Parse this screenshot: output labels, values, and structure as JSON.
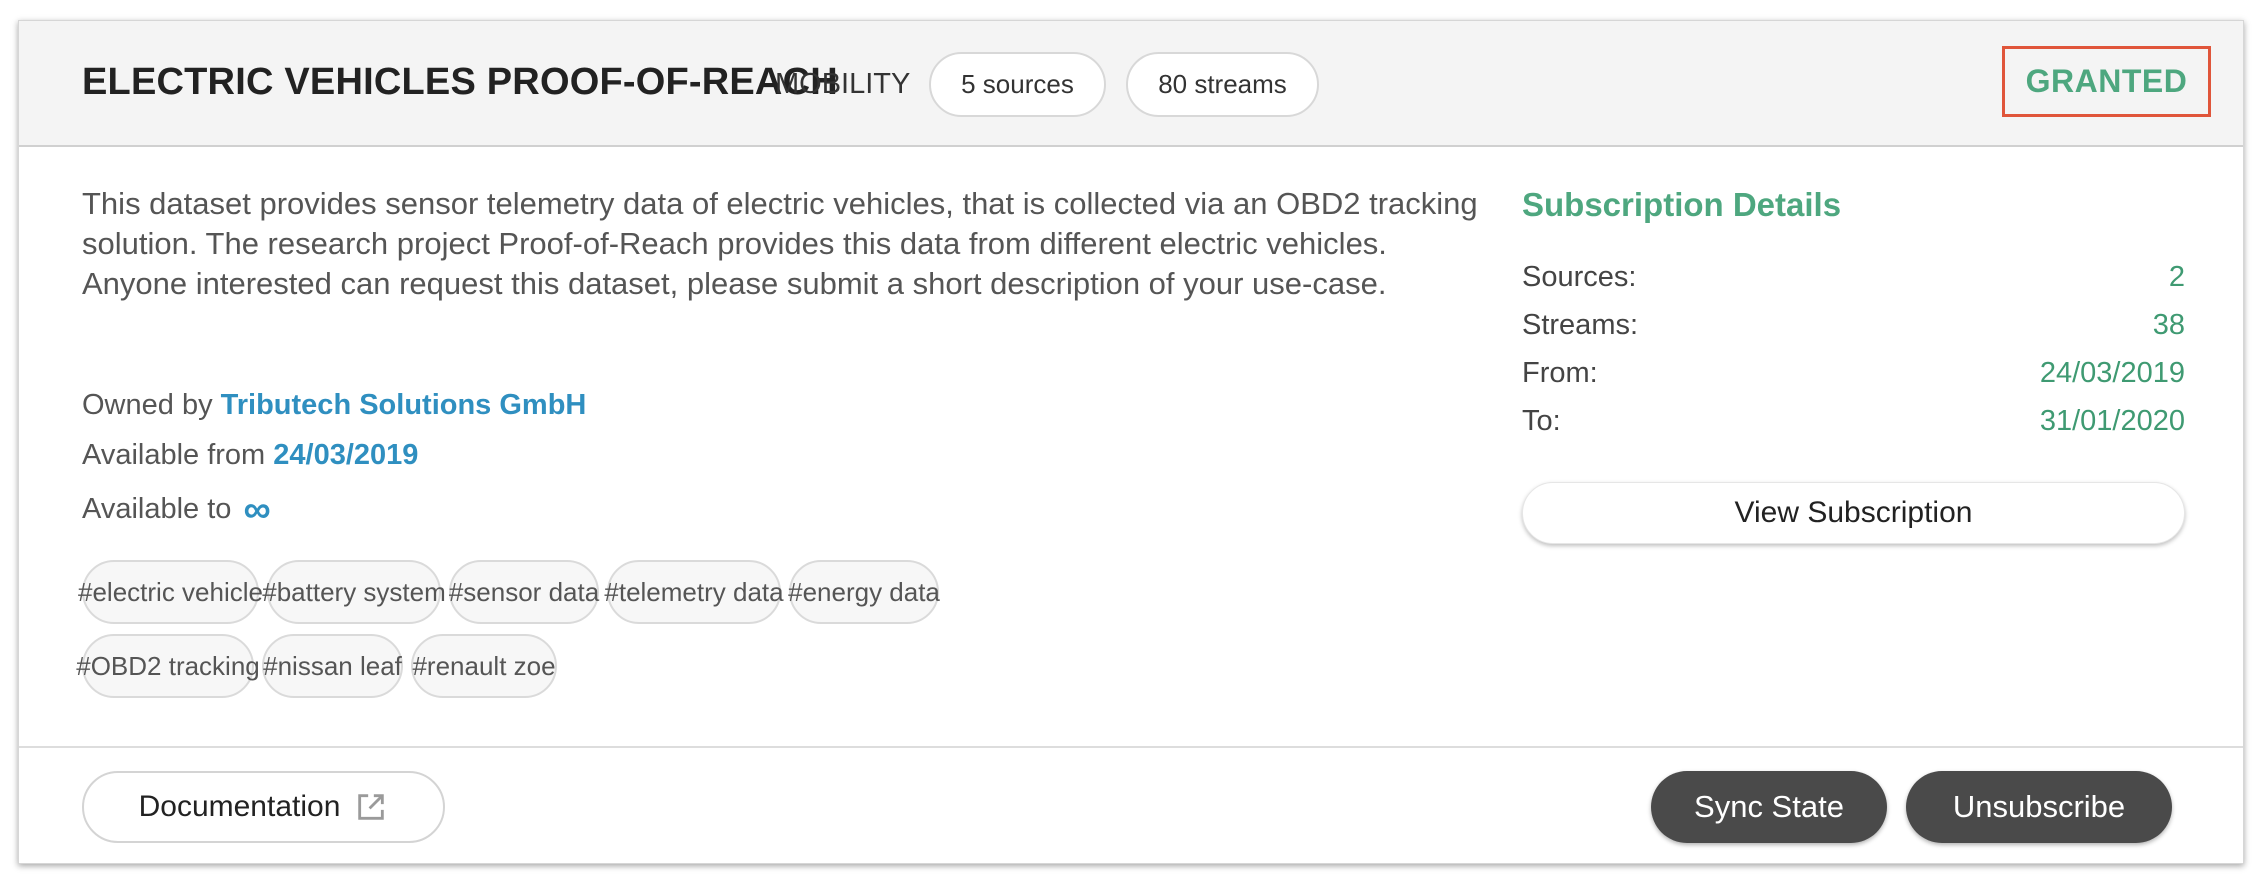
{
  "header": {
    "title": "ELECTRIC VEHICLES PROOF-OF-REACH",
    "category": "MOBILITY",
    "sources_pill": "5 sources",
    "streams_pill": "80 streams",
    "status": "GRANTED"
  },
  "description": "This dataset provides sensor telemetry data of electric vehicles, that is collected via an OBD2 tracking solution. The research project Proof-of-Reach provides this data from different electric vehicles. Anyone interested can request this dataset, please submit a short description of your use-case.",
  "meta": {
    "owned_label": "Owned by",
    "owner": "Tributech Solutions GmbH",
    "available_from_label": "Available from",
    "available_from": "24/03/2019",
    "available_to_label": "Available to",
    "available_to": "∞"
  },
  "tags": [
    "#electric vehicle",
    "#battery system",
    "#sensor data",
    "#telemetry data",
    "#energy data",
    "#OBD2 tracking",
    "#nissan leaf",
    "#renault zoe"
  ],
  "subscription": {
    "title": "Subscription Details",
    "rows": [
      {
        "label": "Sources:",
        "value": "2"
      },
      {
        "label": "Streams:",
        "value": "38"
      },
      {
        "label": "From:",
        "value": "24/03/2019"
      },
      {
        "label": "To:",
        "value": "31/01/2020"
      }
    ],
    "view_button": "View Subscription"
  },
  "footer": {
    "documentation": "Documentation",
    "sync_state": "Sync State",
    "unsubscribe": "Unsubscribe"
  },
  "colors": {
    "accent_green": "#4ea77f",
    "link_blue": "#2f8fc0",
    "status_border": "#e0553a",
    "dark_button": "#4a4a4a"
  }
}
